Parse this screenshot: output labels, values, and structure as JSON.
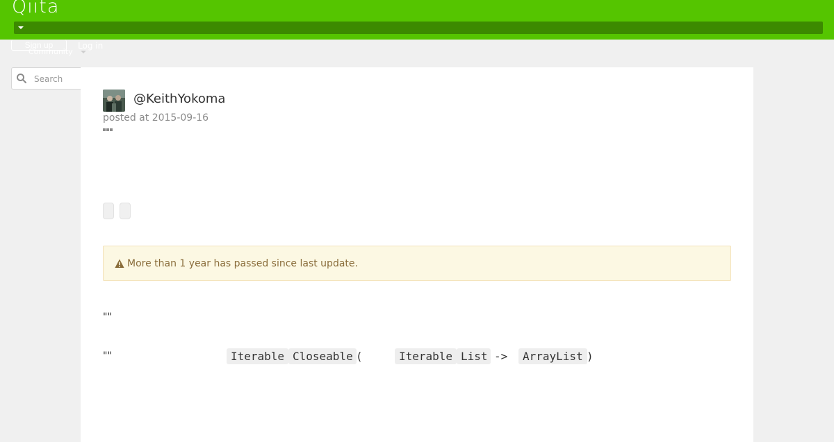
{
  "header": {
    "logo": "Qiita",
    "signup_label": "Sign up",
    "login_label": "Log in",
    "community_label": "Community",
    "search_placeholder": "Search",
    "brand_color": "#55c500"
  },
  "article": {
    "author": "@KeithYokoma",
    "posted": "posted at 2015-09-16",
    "alert_text": "More than 1 year has passed since last update.",
    "paragraph_1": "\"\"",
    "paragraph_2_prefix": "\"\"",
    "inline_code": {
      "iterable_1": "Iterable",
      "closeable": "Closeable",
      "paren_open": "(",
      "iterable_2": "Iterable",
      "list": "List",
      "arrow": "->",
      "arraylist": "ArrayList",
      "paren_close": ")"
    }
  }
}
